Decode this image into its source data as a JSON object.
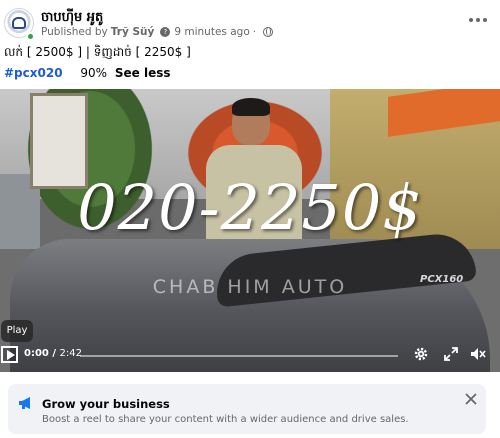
{
  "header": {
    "page_name": "ចាបហ៊ីម អូតូ",
    "published_by_label": "Published by",
    "author": "Trỹ Süý",
    "time_ago": "9 minutes ago",
    "separator": "·",
    "more_icon": "ellipsis-icon",
    "privacy_icon": "globe-icon"
  },
  "caption": {
    "line1": "លក់  [ 2500$ ]   | ទិញដាច់   [ 2250$ ]",
    "hashtag": "#pcx020",
    "percent": "90%",
    "see_less": "See less"
  },
  "video": {
    "overlay_price": "020-2250$",
    "watermark": "CHAB HIM AUTO",
    "model_badge": "PCX160",
    "play_tooltip": "Play",
    "current_time": "0:00",
    "time_separator": " / ",
    "total_time": "2:42",
    "progress": 0,
    "icons": [
      "play-icon",
      "gear-icon",
      "fullscreen-icon",
      "mute-icon"
    ]
  },
  "promo": {
    "title": "Grow your business",
    "text": "Boost a reel to share your content with a wider audience and drive sales.",
    "icon": "megaphone-icon",
    "accent_color": "#1877f2"
  },
  "colors": {
    "link": "#1d5bd8",
    "meta_text": "#65676b",
    "card_bg": "#f0f2f5",
    "online": "#31a24c"
  }
}
